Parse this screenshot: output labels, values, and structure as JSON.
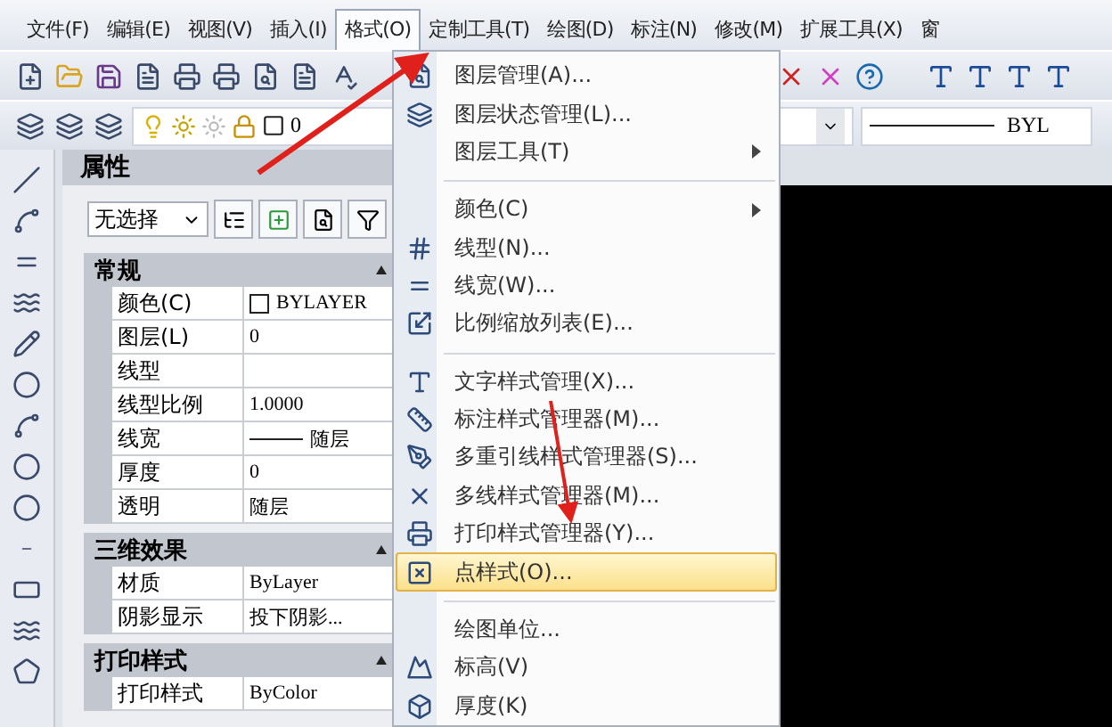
{
  "menu_bar": [
    {
      "label": "文件(F)",
      "selected": false
    },
    {
      "label": "编辑(E)",
      "selected": false
    },
    {
      "label": "视图(V)",
      "selected": false
    },
    {
      "label": "插入(I)",
      "selected": false
    },
    {
      "label": "格式(O)",
      "selected": true
    },
    {
      "label": "定制工具(T)",
      "selected": false
    },
    {
      "label": "绘图(D)",
      "selected": false
    },
    {
      "label": "标注(N)",
      "selected": false
    },
    {
      "label": "修改(M)",
      "selected": false
    },
    {
      "label": "扩展工具(X)",
      "selected": false
    },
    {
      "label": "窗",
      "selected": false
    }
  ],
  "layer_combo": {
    "value": "0"
  },
  "lineweight_combo": {
    "value": "BYL"
  },
  "properties_panel": {
    "title": "属性",
    "selection": "无选择",
    "groups": [
      {
        "title": "常规",
        "expanded": true,
        "rows": [
          {
            "name": "颜色(C)",
            "value": "BYLAYER",
            "kind": "color"
          },
          {
            "name": "图层(L)",
            "value": "0",
            "kind": "text"
          },
          {
            "name": "线型",
            "value": "",
            "kind": "text"
          },
          {
            "name": "线型比例",
            "value": "1.0000",
            "kind": "text"
          },
          {
            "name": "线宽",
            "value": "随层",
            "kind": "lineweight"
          },
          {
            "name": "厚度",
            "value": "0",
            "kind": "text"
          },
          {
            "name": "透明",
            "value": "随层",
            "kind": "text"
          }
        ]
      },
      {
        "title": "三维效果",
        "expanded": true,
        "rows": [
          {
            "name": "材质",
            "value": "ByLayer",
            "kind": "text"
          },
          {
            "name": "阴影显示",
            "value": "投下阴影...",
            "kind": "text"
          }
        ]
      },
      {
        "title": "打印样式",
        "expanded": true,
        "rows": [
          {
            "name": "打印样式",
            "value": "ByColor",
            "kind": "text"
          }
        ]
      }
    ]
  },
  "format_menu": {
    "sections": [
      {
        "items": [
          {
            "label": "图层管理(A)...",
            "submenu": false,
            "selected": false
          },
          {
            "label": "图层状态管理(L)...",
            "submenu": false,
            "selected": false
          },
          {
            "label": "图层工具(T)",
            "submenu": true,
            "selected": false
          }
        ]
      },
      {
        "items": [
          {
            "label": "颜色(C)",
            "submenu": true,
            "selected": false
          },
          {
            "label": "线型(N)...",
            "submenu": false,
            "selected": false
          },
          {
            "label": "线宽(W)...",
            "submenu": false,
            "selected": false
          },
          {
            "label": "比例缩放列表(E)...",
            "submenu": false,
            "selected": false
          }
        ]
      },
      {
        "items": [
          {
            "label": "文字样式管理(X)...",
            "submenu": false,
            "selected": false
          },
          {
            "label": "标注样式管理器(M)...",
            "submenu": false,
            "selected": false
          },
          {
            "label": "多重引线样式管理器(S)...",
            "submenu": false,
            "selected": false
          },
          {
            "label": "多线样式管理器(M)...",
            "submenu": false,
            "selected": false
          },
          {
            "label": "打印样式管理器(Y)...",
            "submenu": false,
            "selected": false
          },
          {
            "label": "点样式(O)...",
            "submenu": false,
            "selected": true
          }
        ]
      },
      {
        "items": [
          {
            "label": "绘图单位...",
            "submenu": false,
            "selected": false
          },
          {
            "label": "标高(V)",
            "submenu": false,
            "selected": false
          },
          {
            "label": "厚度(K)",
            "submenu": false,
            "selected": false
          }
        ]
      }
    ]
  }
}
